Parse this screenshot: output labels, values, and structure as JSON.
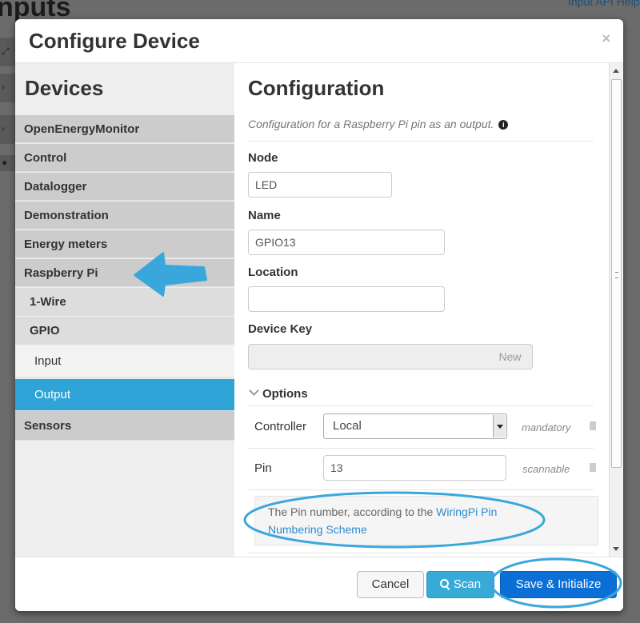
{
  "background": {
    "page_title": "nputs",
    "help_link": "Input API Help"
  },
  "modal": {
    "title": "Configure Device",
    "close_glyph": "×"
  },
  "sidebar": {
    "heading": "Devices",
    "items": [
      {
        "label": "OpenEnergyMonitor",
        "level": 0
      },
      {
        "label": "Control",
        "level": 0
      },
      {
        "label": "Datalogger",
        "level": 0
      },
      {
        "label": "Demonstration",
        "level": 0
      },
      {
        "label": "Energy meters",
        "level": 0
      },
      {
        "label": "Raspberry Pi",
        "level": 0
      },
      {
        "label": "1-Wire",
        "level": 1
      },
      {
        "label": "GPIO",
        "level": 1
      },
      {
        "label": "Input",
        "level": 2
      },
      {
        "label": "Output",
        "level": 2,
        "active": true
      },
      {
        "label": "Sensors",
        "level": 0
      }
    ]
  },
  "config": {
    "title": "Configuration",
    "description": "Configuration for a Raspberry Pi pin as an output.",
    "info_glyph": "i",
    "node_label": "Node",
    "node_value": "LED",
    "name_label": "Name",
    "name_value": "GPIO13",
    "location_label": "Location",
    "location_value": "",
    "devicekey_label": "Device Key",
    "devicekey_value": "",
    "new_label": "New",
    "options_label": "Options",
    "options": [
      {
        "label": "Controller",
        "value": "Local",
        "type": "select",
        "hint": "mandatory"
      },
      {
        "label": "Pin",
        "value": "13",
        "type": "text",
        "hint": "scannable"
      }
    ],
    "help_prefix": "The Pin number, according to the ",
    "help_link": "WiringPi Pin Numbering Scheme"
  },
  "footer": {
    "cancel_label": "Cancel",
    "scan_label": "Scan",
    "save_label": "Save & Initialize"
  },
  "annotation_color": "#3aa7dc"
}
